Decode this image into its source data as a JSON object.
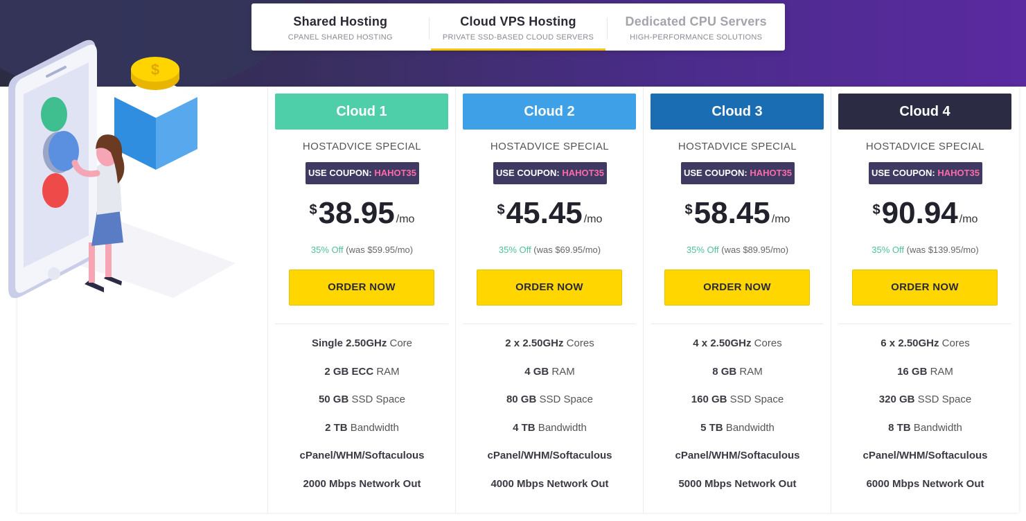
{
  "tabs": [
    {
      "title": "Shared Hosting",
      "subtitle": "CPANEL SHARED HOSTING",
      "state": "normal"
    },
    {
      "title": "Cloud VPS Hosting",
      "subtitle": "PRIVATE SSD-BASED CLOUD SERVERS",
      "state": "active"
    },
    {
      "title": "Dedicated CPU Servers",
      "subtitle": "HIGH-PERFORMANCE SOLUTIONS",
      "state": "inactive"
    }
  ],
  "coupon_prefix": "USE COUPON: ",
  "coupon_code": "HAHOT35",
  "special_label": "HOSTADVICE SPECIAL",
  "currency": "$",
  "period": "/mo",
  "order_label": "ORDER NOW",
  "off_label": "35% Off",
  "plans": [
    {
      "name": "Cloud 1",
      "color": "#4fcfa9",
      "price": "38.95",
      "was": "(was $59.95/mo)",
      "features": [
        {
          "b": "Single 2.50GHz",
          "t": " Core"
        },
        {
          "b": "2 GB ECC",
          "t": " RAM"
        },
        {
          "b": "50 GB",
          "t": " SSD Space"
        },
        {
          "b": "2 TB",
          "t": " Bandwidth"
        },
        {
          "b": "cPanel/WHM/Softaculous",
          "t": ""
        },
        {
          "b": "2000 Mbps Network Out",
          "t": ""
        }
      ]
    },
    {
      "name": "Cloud 2",
      "color": "#3ea0e6",
      "price": "45.45",
      "was": "(was $69.95/mo)",
      "features": [
        {
          "b": "2 x 2.50GHz",
          "t": " Cores"
        },
        {
          "b": "4 GB",
          "t": " RAM"
        },
        {
          "b": "80 GB",
          "t": " SSD Space"
        },
        {
          "b": "4 TB",
          "t": " Bandwidth"
        },
        {
          "b": "cPanel/WHM/Softaculous",
          "t": ""
        },
        {
          "b": "4000 Mbps Network Out",
          "t": ""
        }
      ]
    },
    {
      "name": "Cloud 3",
      "color": "#1b6db3",
      "price": "58.45",
      "was": "(was $89.95/mo)",
      "features": [
        {
          "b": "4 x 2.50GHz",
          "t": " Cores"
        },
        {
          "b": "8 GB",
          "t": " RAM"
        },
        {
          "b": "160 GB",
          "t": " SSD Space"
        },
        {
          "b": "5 TB",
          "t": " Bandwidth"
        },
        {
          "b": "cPanel/WHM/Softaculous",
          "t": ""
        },
        {
          "b": "5000 Mbps Network Out",
          "t": ""
        }
      ]
    },
    {
      "name": "Cloud 4",
      "color": "#2b2c44",
      "price": "90.94",
      "was": "(was $139.95/mo)",
      "features": [
        {
          "b": "6 x 2.50GHz",
          "t": " Cores"
        },
        {
          "b": "16 GB",
          "t": " RAM"
        },
        {
          "b": "320 GB",
          "t": " SSD Space"
        },
        {
          "b": "8 TB",
          "t": " Bandwidth"
        },
        {
          "b": "cPanel/WHM/Softaculous",
          "t": ""
        },
        {
          "b": "6000 Mbps Network Out",
          "t": ""
        }
      ]
    }
  ]
}
